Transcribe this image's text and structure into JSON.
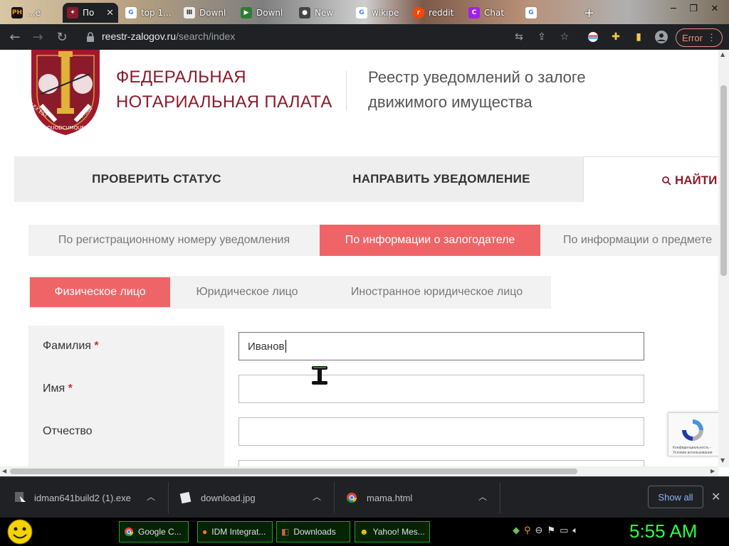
{
  "browser": {
    "tabs": [
      {
        "favicon": "PH",
        "title": "...e",
        "color": "#f7971e"
      },
      {
        "favicon": "seal",
        "title": "По",
        "color": "#8b1a2b",
        "active": true
      },
      {
        "favicon": "G",
        "title": "top 1...",
        "color": "#4285f4"
      },
      {
        "favicon": "lib",
        "title": "Downl",
        "color": "#555555"
      },
      {
        "favicon": "flag",
        "title": "Downl",
        "color": "#2e7d32"
      },
      {
        "favicon": "gh",
        "title": "New",
        "color": "#444444"
      },
      {
        "favicon": "G",
        "title": "wikipe",
        "color": "#4285f4"
      },
      {
        "favicon": "r",
        "title": "reddit",
        "color": "#ff4500"
      },
      {
        "favicon": "C",
        "title": "Chat",
        "color": "#a020f0"
      },
      {
        "favicon": "G",
        "title": "",
        "color": "#4285f4"
      }
    ],
    "new_tab": "+",
    "url_host": "reestr-zalogov.ru",
    "url_path": "/search/index",
    "error_label": "Error"
  },
  "site": {
    "org_line1": "ФЕДЕРАЛЬНАЯ",
    "org_line2": "НОТАРИАЛЬНАЯ ПАЛАТА",
    "registry_line1": "Реестр уведомлений о залоге",
    "registry_line2": "движимого имущества",
    "logo_motto_left": "LEX EST",
    "logo_motto_right": "NORMA",
    "logo_motto_bottom": "QUODCUMQUE"
  },
  "nav": {
    "check_status": "ПРОВЕРИТЬ СТАТУС",
    "send_notice": "НАПРАВИТЬ УВЕДОМЛЕНИЕ",
    "find": "НАЙТИ"
  },
  "search_tabs": [
    "По регистрационному номеру уведомления",
    "По информации о залогодателе",
    "По информации о предмете"
  ],
  "person_tabs": [
    "Физическое лицо",
    "Юридическое лицо",
    "Иностранное юридическое лицо"
  ],
  "form": {
    "surname_label": "Фамилия",
    "surname_value": "Иванов",
    "name_label": "Имя",
    "name_value": "",
    "patronymic_label": "Отчество",
    "patronymic_value": "",
    "required_mark": "*"
  },
  "recaptcha": {
    "line1": "Конфиденциальность -",
    "line2": "Условия использования"
  },
  "downloads": {
    "items": [
      {
        "name": "idman641build2 (1).exe"
      },
      {
        "name": "download.jpg"
      },
      {
        "name": "mama.html"
      }
    ],
    "show_all": "Show all",
    "close": "✕"
  },
  "taskbar": {
    "buttons": [
      "Google C...",
      "IDM Integrat...",
      "Downloads",
      "Yahoo! Mes..."
    ],
    "clock": "5:55 AM"
  },
  "colors": {
    "brand": "#8b1a2b",
    "accent": "#ef6467",
    "chrome_bg": "#202124",
    "clock": "#2cff3a"
  }
}
